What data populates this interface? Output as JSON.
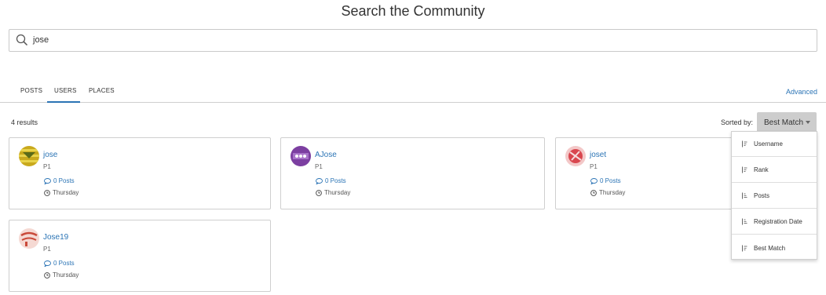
{
  "page": {
    "title": "Search the Community"
  },
  "search": {
    "value": "jose",
    "icon": "search-icon"
  },
  "tabs": [
    {
      "label": "POSTS",
      "active": false
    },
    {
      "label": "USERS",
      "active": true
    },
    {
      "label": "PLACES",
      "active": false
    }
  ],
  "advanced_label": "Advanced",
  "results": {
    "count_text": "4 results"
  },
  "sort": {
    "label": "Sorted by:",
    "selected": "Best Match",
    "options": [
      "Username",
      "Rank",
      "Posts",
      "Registration Date",
      "Best Match"
    ]
  },
  "users": [
    {
      "name": "jose",
      "rank": "P1",
      "posts": "0 Posts",
      "date": "Thursday",
      "avatar_color": "#c9a91d"
    },
    {
      "name": "AJose",
      "rank": "P1",
      "posts": "0 Posts",
      "date": "Thursday",
      "avatar_color": "#7c3fa1"
    },
    {
      "name": "joset",
      "rank": "P1",
      "posts": "0 Posts",
      "date": "Thursday",
      "avatar_color": "#d9474f"
    },
    {
      "name": "Jose19",
      "rank": "P1",
      "posts": "0 Posts",
      "date": "Thursday",
      "avatar_color": "#c94a3a"
    }
  ],
  "colors": {
    "link": "#2b74b5",
    "sort_button": "#cdcdcd",
    "border": "#cfcfcf"
  }
}
